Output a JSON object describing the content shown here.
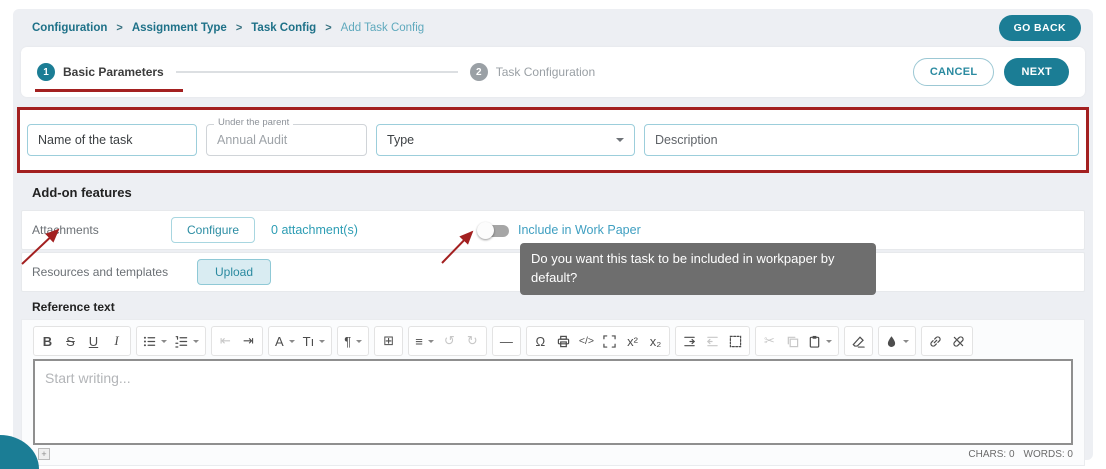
{
  "colors": {
    "accent": "#1b7d95",
    "link_teal": "#2d9db4",
    "annotation_red": "#a32020",
    "tooltip_bg": "#6e6e6e"
  },
  "header": {
    "breadcrumb": [
      "Configuration",
      "Assignment Type",
      "Task Config",
      "Add Task Config"
    ],
    "separator": ">",
    "go_back_label": "GO BACK"
  },
  "stepper": {
    "steps": [
      {
        "num": "1",
        "label": "Basic Parameters"
      },
      {
        "num": "2",
        "label": "Task Configuration"
      }
    ],
    "active_step": "1",
    "cancel_label": "CANCEL",
    "next_label": "NEXT"
  },
  "form_fields": {
    "name": {
      "placeholder": "Name of the task"
    },
    "parent": {
      "label": "Under the parent",
      "value": "Annual Audit"
    },
    "type": {
      "value": "Type"
    },
    "description": {
      "placeholder": "Description"
    }
  },
  "addon": {
    "heading": "Add-on features",
    "attachments": {
      "label": "Attachments",
      "button_label": "Configure",
      "count_text": "0 attachment(s)",
      "toggle_state": "off",
      "toggle_label": "Include in Work Paper"
    },
    "resources": {
      "label": "Resources and templates",
      "button_label": "Upload"
    },
    "tooltip_text": "Do you want this task to be included in workpaper by default?"
  },
  "reference": {
    "heading": "Reference text",
    "placeholder": "Start writing...",
    "chars_text": "CHARS: 0",
    "words_text": "WORDS: 0",
    "resize_glyph": "+"
  },
  "toolbar_groups": [
    [
      {
        "name": "bold",
        "glyph": "B",
        "cls": "b"
      },
      {
        "name": "strikethrough",
        "glyph": "S",
        "cls": "s"
      },
      {
        "name": "underline",
        "glyph": "U",
        "cls": "u"
      },
      {
        "name": "italic",
        "glyph": "I",
        "cls": "i"
      }
    ],
    [
      {
        "name": "unordered-list",
        "svg": "list-ul",
        "caret": true
      },
      {
        "name": "ordered-list",
        "svg": "list-ol",
        "caret": true
      }
    ],
    [
      {
        "name": "outdent",
        "glyph": "⇤",
        "disabled": true
      },
      {
        "name": "indent",
        "glyph": "⇥"
      }
    ],
    [
      {
        "name": "text-color",
        "glyph": "A",
        "caret": true
      },
      {
        "name": "font-size",
        "glyph": "Tı",
        "caret": true
      }
    ],
    [
      {
        "name": "paragraph-format",
        "glyph": "¶",
        "caret": true
      }
    ],
    [
      {
        "name": "insert-table",
        "glyph": "⊞"
      }
    ],
    [
      {
        "name": "align",
        "glyph": "≡",
        "caret": true
      },
      {
        "name": "undo",
        "glyph": "↺",
        "disabled": true
      },
      {
        "name": "redo",
        "glyph": "↻",
        "disabled": true
      }
    ],
    [
      {
        "name": "horizontal-line",
        "glyph": "—"
      }
    ],
    [
      {
        "name": "special-characters",
        "glyph": "Ω"
      },
      {
        "name": "print",
        "svg": "print"
      },
      {
        "name": "code-view",
        "glyph": "</>",
        "cls": "small"
      },
      {
        "name": "fullscreen",
        "svg": "fullscreen"
      },
      {
        "name": "superscript",
        "glyph": "x²"
      },
      {
        "name": "subscript",
        "glyph": "x₂"
      }
    ],
    [
      {
        "name": "indent-block",
        "svg": "indent-block"
      },
      {
        "name": "outdent-block",
        "svg": "outdent-block",
        "disabled": true
      },
      {
        "name": "select-all",
        "svg": "select-all"
      }
    ],
    [
      {
        "name": "cut",
        "glyph": "✂",
        "disabled": true
      },
      {
        "name": "copy",
        "svg": "copy",
        "disabled": true
      },
      {
        "name": "paste",
        "svg": "paste",
        "caret": true
      }
    ],
    [
      {
        "name": "clear-formatting",
        "svg": "eraser"
      }
    ],
    [
      {
        "name": "highlight-color",
        "svg": "droplet",
        "caret": true
      }
    ],
    [
      {
        "name": "insert-link",
        "svg": "link"
      },
      {
        "name": "unlink",
        "svg": "unlink"
      }
    ]
  ]
}
